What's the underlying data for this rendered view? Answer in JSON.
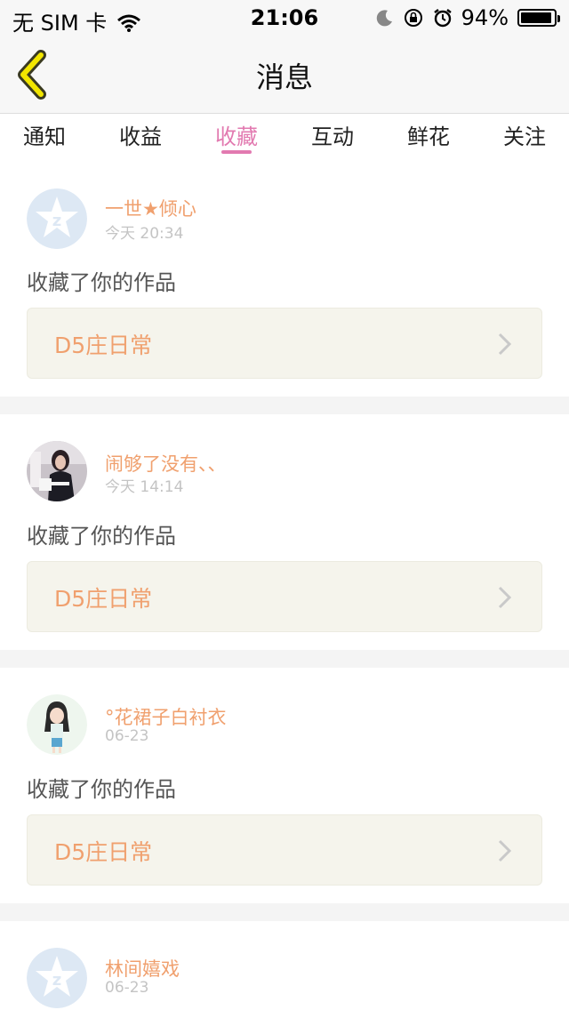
{
  "status": {
    "carrier": "无 SIM 卡",
    "time": "21:06",
    "battery": "94%",
    "battery_level": 0.94
  },
  "nav": {
    "title": "消息"
  },
  "tabs": [
    {
      "label": "通知"
    },
    {
      "label": "收益"
    },
    {
      "label": "收藏"
    },
    {
      "label": "互动"
    },
    {
      "label": "鲜花"
    },
    {
      "label": "关注"
    }
  ],
  "active_tab": "收藏",
  "colors": {
    "accent": "#e27ab0",
    "username": "#f0a06e",
    "card_bg": "#f5f4ec"
  },
  "items": [
    {
      "user": "一世★倾心",
      "time": "今天 20:34",
      "action": "收藏了你的作品",
      "work": "D5庄日常",
      "avatar": "default-avatar-icon"
    },
    {
      "user": "闹够了没有、、",
      "time": "今天 14:14",
      "action": "收藏了你的作品",
      "work": "D5庄日常",
      "avatar": "photo-avatar"
    },
    {
      "user": "°花裙子白衬衣",
      "time": "06-23",
      "action": "收藏了你的作品",
      "work": "D5庄日常",
      "avatar": "cartoon-girl-avatar"
    },
    {
      "user": "林间嬉戏",
      "time": "06-23",
      "avatar": "default-avatar-icon"
    }
  ]
}
